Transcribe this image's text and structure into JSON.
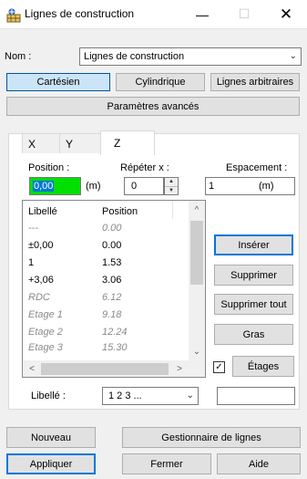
{
  "window": {
    "title": "Lignes de construction",
    "app_icon": "grid-icon"
  },
  "nom": {
    "label": "Nom :",
    "value": "Lignes de construction"
  },
  "modes": {
    "cartesien": "Cartésien",
    "cylindrique": "Cylindrique",
    "lignes_arbitraires": "Lignes arbitraires",
    "active": "cartesien"
  },
  "advanced_button": "Paramètres avancés",
  "tabs": [
    {
      "label": "X"
    },
    {
      "label": "Y"
    },
    {
      "label": "Z",
      "active": true
    }
  ],
  "position": {
    "label": "Position :",
    "value": "0,00",
    "unit": "(m)"
  },
  "repeter": {
    "label": "Répéter x :",
    "value": "0"
  },
  "espacement": {
    "label": "Espacement :",
    "value": "1",
    "unit": "(m)"
  },
  "list": {
    "col_libelle": "Libellé",
    "col_position": "Position",
    "rows": [
      {
        "libelle": "---",
        "position": "0.00",
        "italic": true
      },
      {
        "libelle": "±0,00",
        "position": "0.00",
        "italic": false
      },
      {
        "libelle": "1",
        "position": "1.53",
        "italic": false
      },
      {
        "libelle": "+3,06",
        "position": "3.06",
        "italic": false
      },
      {
        "libelle": "RDC",
        "position": "6.12",
        "italic": true
      },
      {
        "libelle": "Etage 1",
        "position": "9.18",
        "italic": true
      },
      {
        "libelle": "Etage 2",
        "position": "12.24",
        "italic": true
      },
      {
        "libelle": "Etage 3",
        "position": "15.30",
        "italic": true
      }
    ]
  },
  "side_buttons": {
    "inserer": "Insérer",
    "supprimer": "Supprimer",
    "supprimer_tout": "Supprimer tout",
    "gras": "Gras"
  },
  "etages": {
    "label": "Étages",
    "checked": true
  },
  "libelle_combo": {
    "label": "Libellé :",
    "value": "1 2 3 ..."
  },
  "libelle_text": {
    "value": ""
  },
  "bottom": {
    "nouveau": "Nouveau",
    "gestionnaire": "Gestionnaire de lignes",
    "appliquer": "Appliquer",
    "fermer": "Fermer",
    "aide": "Aide"
  }
}
